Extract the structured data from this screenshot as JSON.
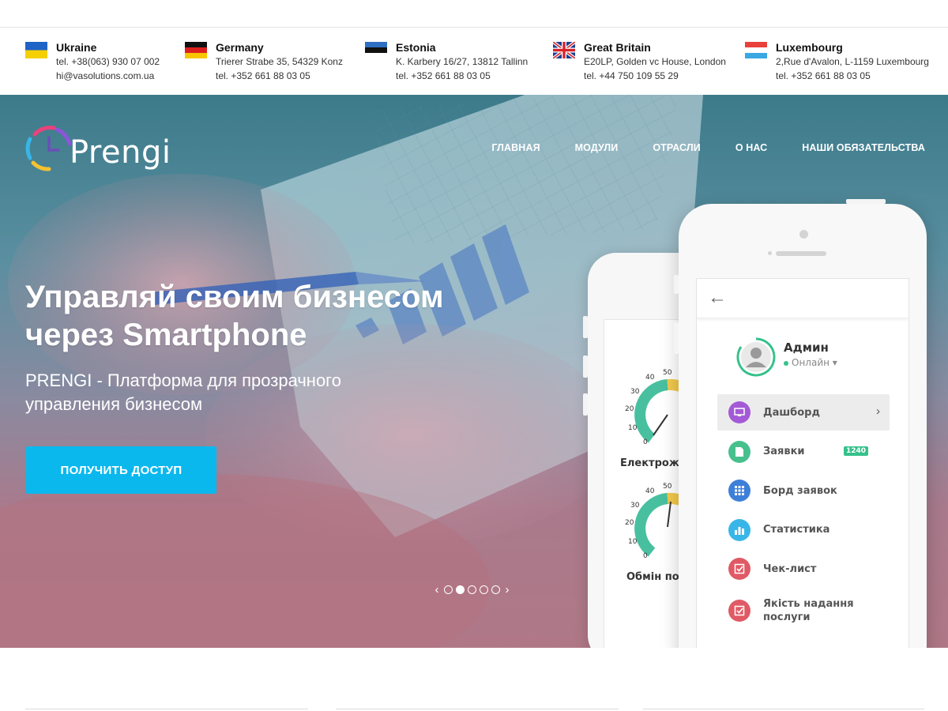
{
  "offices": [
    {
      "country": "Ukraine",
      "line1": "tel. +38(063) 930 07 002",
      "line2": "hi@vasolutions.com.ua",
      "flag": "flag-ukraine-icon"
    },
    {
      "country": "Germany",
      "line1": "Trierer Strabe 35, 54329 Konz",
      "line2": "tel. +352 661 88 03 05",
      "flag": "flag-germany-icon"
    },
    {
      "country": "Estonia",
      "line1": "K. Karbery 16/27, 13812 Tallinn",
      "line2": "tel. +352 661 88 03 05",
      "flag": "flag-estonia-icon"
    },
    {
      "country": "Great Britain",
      "line1": "E20LP, Golden vc House, London",
      "line2": "tel. +44 750 109 55 29",
      "flag": "flag-uk-icon"
    },
    {
      "country": "Luxembourg",
      "line1": "2,Rue d'Avalon, L-1159 Luxembourg",
      "line2": "tel. +352 661 88 03 05",
      "flag": "flag-luxembourg-icon"
    }
  ],
  "logo": {
    "text": "Prengi"
  },
  "nav": [
    "ГЛАВНАЯ",
    "МОДУЛИ",
    "ОТРАСЛИ",
    "О НАС",
    "НАШИ ОБЯЗАТЕЛЬСТВА"
  ],
  "hero": {
    "headline": "Управляй своим бизнесом через Smartphone",
    "subline": "PRENGI - Платформа для прозрачного управления бизнесом",
    "cta": "ПОЛУЧИТЬ ДОСТУП"
  },
  "slider": {
    "dots": 5,
    "active_index": 1
  },
  "phone_back": {
    "gauges": [
      {
        "ticks": [
          "40",
          "30",
          "20",
          "10",
          "0"
        ],
        "top_tick": "50",
        "label": "Електрожи"
      },
      {
        "ticks": [
          "40",
          "30",
          "20",
          "10",
          "0"
        ],
        "top_tick": "50",
        "label": "Обмін по"
      }
    ]
  },
  "phone_front": {
    "user": {
      "name": "Админ",
      "status": "Онлайн"
    },
    "menu": [
      {
        "label": "Дашборд",
        "color": "#a45ad6",
        "icon": "monitor-icon",
        "active": true
      },
      {
        "label": "Заявки",
        "color": "#48c08e",
        "icon": "document-icon",
        "badge": "1240"
      },
      {
        "label": "Борд заявок",
        "color": "#3d7fd9",
        "icon": "grid-icon"
      },
      {
        "label": "Статистика",
        "color": "#39b6e8",
        "icon": "bar-chart-icon"
      },
      {
        "label": "Чек-лист",
        "color": "#e05a66",
        "icon": "checkbox-icon"
      },
      {
        "label": "Якість надання послуги",
        "color": "#e05a66",
        "icon": "checkbox-icon"
      }
    ]
  },
  "colors": {
    "accent": "#0ab8ee",
    "online": "#35c18b",
    "gauge_green": "#48c0a0",
    "gauge_yellow": "#f2c94c"
  }
}
